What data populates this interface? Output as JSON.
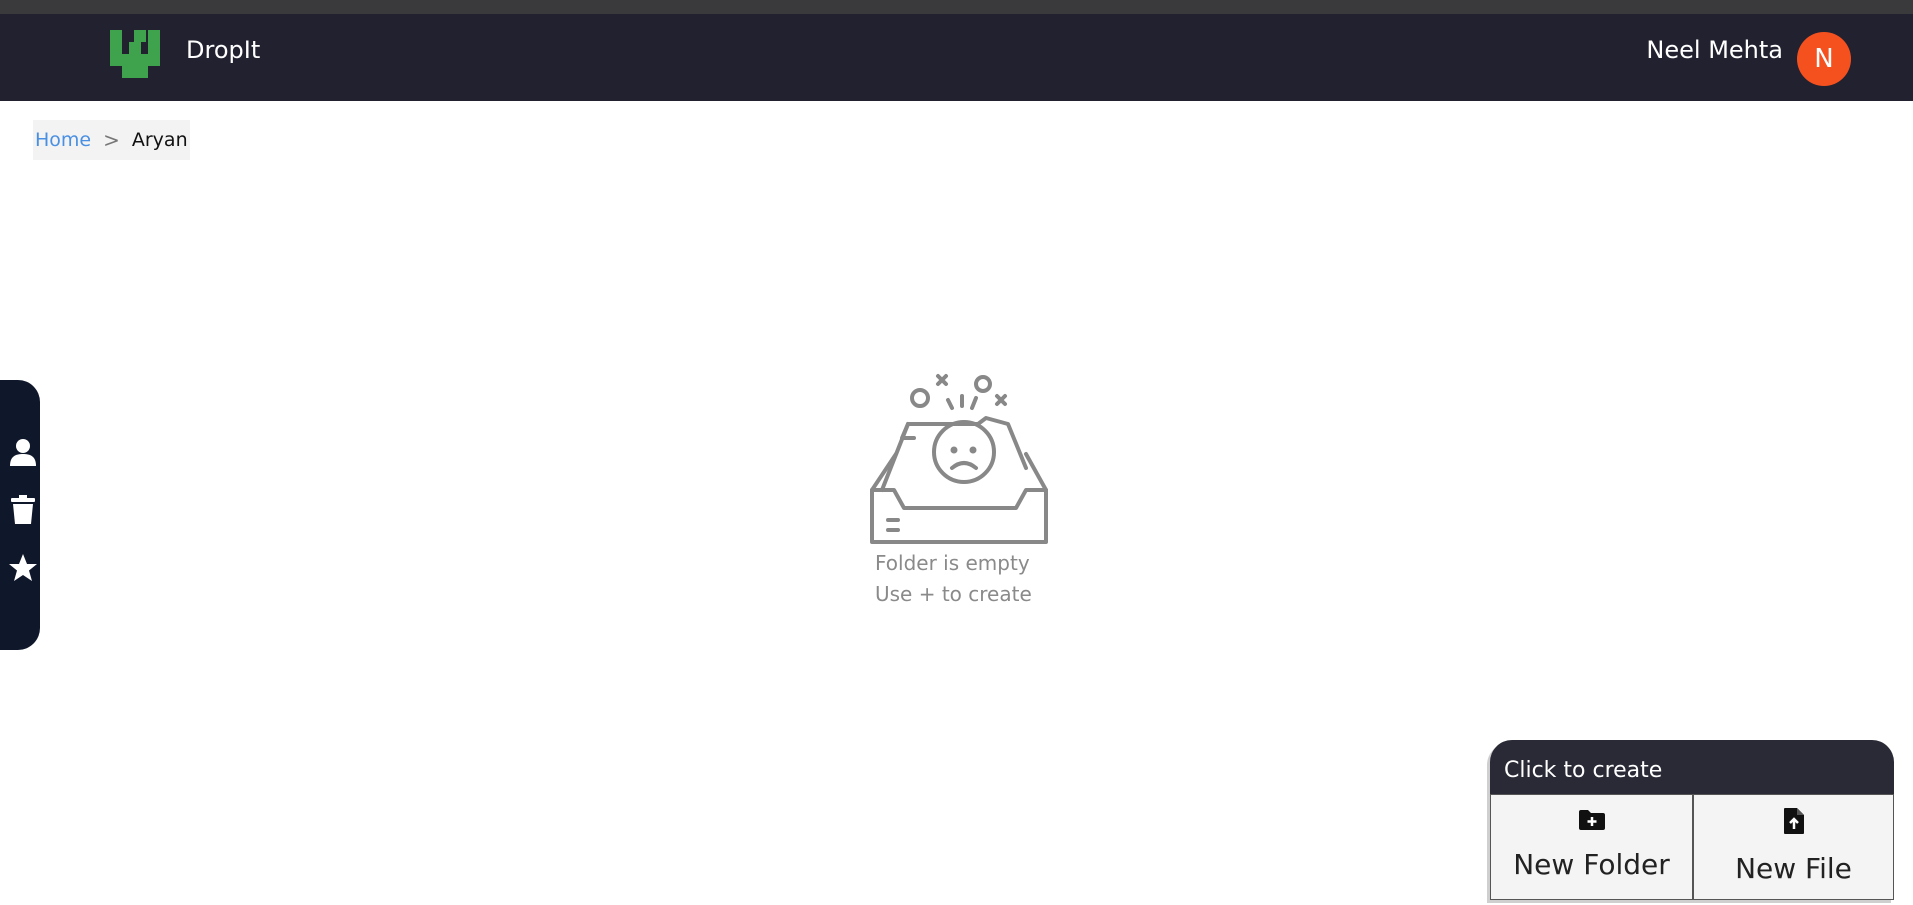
{
  "app": {
    "brand": "DropIt",
    "user_name": "Neel Mehta",
    "avatar_letter": "N"
  },
  "breadcrumb": {
    "home": "Home",
    "separator": ">",
    "current": "Aryan"
  },
  "sidebar": {
    "items": [
      {
        "icon": "user-icon"
      },
      {
        "icon": "trash-icon"
      },
      {
        "icon": "star-icon"
      }
    ]
  },
  "empty_state": {
    "line1": "Folder is empty",
    "line2": "Use + to create"
  },
  "create_panel": {
    "title": "Click to create",
    "new_folder": "New Folder",
    "new_file": "New File"
  },
  "colors": {
    "navbar": "#222130",
    "avatar": "#f4511e",
    "logo": "#3fa34d",
    "sidebar": "#0f172a",
    "link": "#4a90e2"
  }
}
